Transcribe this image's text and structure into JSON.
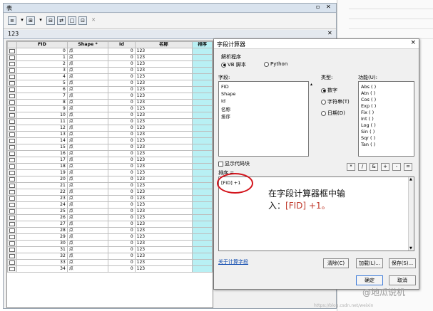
{
  "table_window": {
    "title": "表",
    "tab_label": "123",
    "toolbar_icons": [
      "table-options-icon",
      "dropdown-arrow-icon",
      "related-tables-icon",
      "dropdown-arrow-icon",
      "select-by-attributes-icon",
      "switch-selection-icon",
      "clear-selection-icon",
      "delete-selected-icon"
    ]
  },
  "grid": {
    "columns": [
      "FID",
      "Shape *",
      "Id",
      "名称",
      "排序"
    ],
    "shape_value": "点",
    "id_value": "0",
    "name_value": "123",
    "fids": [
      "0",
      "1",
      "2",
      "3",
      "4",
      "5",
      "6",
      "7",
      "8",
      "9",
      "10",
      "11",
      "12",
      "13",
      "14",
      "15",
      "16",
      "17",
      "18",
      "19",
      "20",
      "21",
      "22",
      "23",
      "24",
      "25",
      "26",
      "27",
      "28",
      "29",
      "30",
      "31",
      "32",
      "33",
      "34"
    ]
  },
  "dialog": {
    "title": "字段计算器",
    "close_glyph": "×",
    "parser_label": "解析程序",
    "parser_options": [
      "VB 脚本",
      "Python"
    ],
    "fields_label": "字段:",
    "fields": [
      "FID",
      "Shape",
      "Id",
      "名称",
      "排序"
    ],
    "type_label": "类型:",
    "type_options": [
      "数字",
      "字符串(T)",
      "日期(D)"
    ],
    "functions_label": "功能(U):",
    "functions": [
      "Abs ( )",
      "Atn ( )",
      "Cos ( )",
      "Exp ( )",
      "Fix ( )",
      "Int ( )",
      "Log ( )",
      "Sin ( )",
      "Sqr ( )",
      "Tan ( )"
    ],
    "show_codeblock_label": "显示代码块",
    "operators": [
      "*",
      "/",
      "&",
      "+",
      "-",
      "="
    ],
    "target_field_label": "排序 =",
    "expression": "[FID] +1",
    "help_link": "关于计算字段",
    "buttons": {
      "clear": "清除(C)",
      "load": "加载(L)...",
      "save": "保存(S)...",
      "ok": "确定",
      "cancel": "取消"
    }
  },
  "annotation": {
    "line1": "在字段计算器框中输",
    "line2_prefix": "入：",
    "line2_highlight": "[FID] +1。"
  },
  "watermark": {
    "main": "@地瓜说机",
    "small": "https://blog.csdn.net/weixin"
  }
}
